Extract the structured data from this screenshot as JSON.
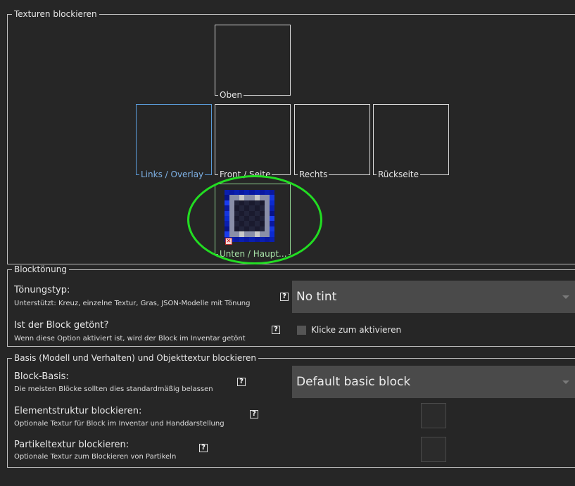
{
  "sections": {
    "textures": {
      "label": "Texturen blockieren",
      "slots": [
        {
          "label": "Oben"
        },
        {
          "label": "Links / Overlay"
        },
        {
          "label": "Front / Seite"
        },
        {
          "label": "Rechts"
        },
        {
          "label": "Rückseite"
        },
        {
          "label": "Unten / Haupt..."
        }
      ]
    },
    "tint": {
      "label": "Blocktönung",
      "tint_type": {
        "title": "Tönungstyp:",
        "subtitle": "Unterstützt: Kreuz, einzelne Textur, Gras, JSON-Modelle mit Tönung",
        "value": "No tint"
      },
      "tinted_in_inventory": {
        "title": "Ist der Block getönt?",
        "subtitle": "Wenn diese Option aktiviert ist, wird der Block im Inventar getönt",
        "checkbox_label": "Klicke zum aktivieren"
      }
    },
    "base": {
      "label": "Basis (Modell und Verhalten) und Objekttextur blockieren",
      "block_base": {
        "title": "Block-Basis:",
        "subtitle": "Die meisten Blöcke sollten dies standardmäßig belassen",
        "value": "Default basic block"
      },
      "item_texture": {
        "title": "Elementstruktur blockieren:",
        "subtitle": "Optionale Textur für Block im Inventar und Handdarstellung"
      },
      "particle_texture": {
        "title": "Partikeltextur blockieren:",
        "subtitle": "Optionale Textur zum Blockieren von Partikeln"
      }
    }
  },
  "help_glyph": "?",
  "badge_glyph": "✕",
  "colors": {
    "background": "#262626",
    "selected_slot": "#5a9bd8",
    "active_slot": "#8fd18f",
    "highlight": "#22dd22",
    "dropdown": "#4a4a4a"
  }
}
